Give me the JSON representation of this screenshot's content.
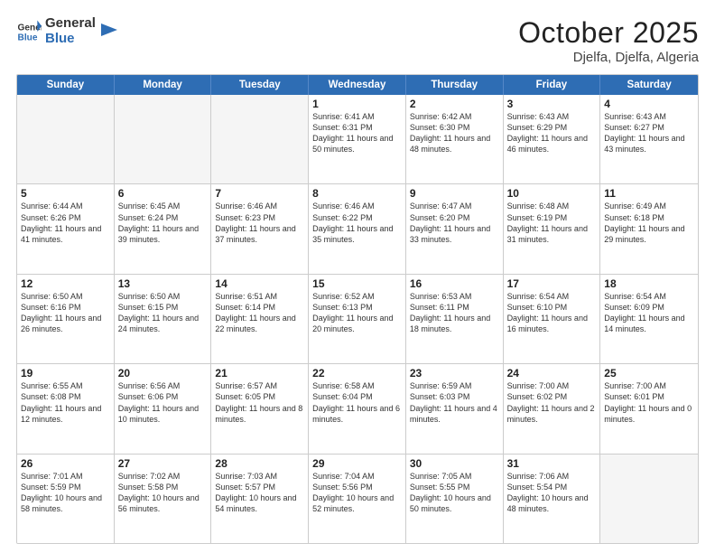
{
  "header": {
    "logo": {
      "general": "General",
      "blue": "Blue"
    },
    "title": "October 2025",
    "location": "Djelfa, Djelfa, Algeria"
  },
  "weekdays": [
    "Sunday",
    "Monday",
    "Tuesday",
    "Wednesday",
    "Thursday",
    "Friday",
    "Saturday"
  ],
  "rows": [
    [
      {
        "date": "",
        "sunrise": "",
        "sunset": "",
        "daylight": "",
        "empty": true
      },
      {
        "date": "",
        "sunrise": "",
        "sunset": "",
        "daylight": "",
        "empty": true
      },
      {
        "date": "",
        "sunrise": "",
        "sunset": "",
        "daylight": "",
        "empty": true
      },
      {
        "date": "1",
        "sunrise": "Sunrise: 6:41 AM",
        "sunset": "Sunset: 6:31 PM",
        "daylight": "Daylight: 11 hours and 50 minutes.",
        "empty": false
      },
      {
        "date": "2",
        "sunrise": "Sunrise: 6:42 AM",
        "sunset": "Sunset: 6:30 PM",
        "daylight": "Daylight: 11 hours and 48 minutes.",
        "empty": false
      },
      {
        "date": "3",
        "sunrise": "Sunrise: 6:43 AM",
        "sunset": "Sunset: 6:29 PM",
        "daylight": "Daylight: 11 hours and 46 minutes.",
        "empty": false
      },
      {
        "date": "4",
        "sunrise": "Sunrise: 6:43 AM",
        "sunset": "Sunset: 6:27 PM",
        "daylight": "Daylight: 11 hours and 43 minutes.",
        "empty": false
      }
    ],
    [
      {
        "date": "5",
        "sunrise": "Sunrise: 6:44 AM",
        "sunset": "Sunset: 6:26 PM",
        "daylight": "Daylight: 11 hours and 41 minutes.",
        "empty": false
      },
      {
        "date": "6",
        "sunrise": "Sunrise: 6:45 AM",
        "sunset": "Sunset: 6:24 PM",
        "daylight": "Daylight: 11 hours and 39 minutes.",
        "empty": false
      },
      {
        "date": "7",
        "sunrise": "Sunrise: 6:46 AM",
        "sunset": "Sunset: 6:23 PM",
        "daylight": "Daylight: 11 hours and 37 minutes.",
        "empty": false
      },
      {
        "date": "8",
        "sunrise": "Sunrise: 6:46 AM",
        "sunset": "Sunset: 6:22 PM",
        "daylight": "Daylight: 11 hours and 35 minutes.",
        "empty": false
      },
      {
        "date": "9",
        "sunrise": "Sunrise: 6:47 AM",
        "sunset": "Sunset: 6:20 PM",
        "daylight": "Daylight: 11 hours and 33 minutes.",
        "empty": false
      },
      {
        "date": "10",
        "sunrise": "Sunrise: 6:48 AM",
        "sunset": "Sunset: 6:19 PM",
        "daylight": "Daylight: 11 hours and 31 minutes.",
        "empty": false
      },
      {
        "date": "11",
        "sunrise": "Sunrise: 6:49 AM",
        "sunset": "Sunset: 6:18 PM",
        "daylight": "Daylight: 11 hours and 29 minutes.",
        "empty": false
      }
    ],
    [
      {
        "date": "12",
        "sunrise": "Sunrise: 6:50 AM",
        "sunset": "Sunset: 6:16 PM",
        "daylight": "Daylight: 11 hours and 26 minutes.",
        "empty": false
      },
      {
        "date": "13",
        "sunrise": "Sunrise: 6:50 AM",
        "sunset": "Sunset: 6:15 PM",
        "daylight": "Daylight: 11 hours and 24 minutes.",
        "empty": false
      },
      {
        "date": "14",
        "sunrise": "Sunrise: 6:51 AM",
        "sunset": "Sunset: 6:14 PM",
        "daylight": "Daylight: 11 hours and 22 minutes.",
        "empty": false
      },
      {
        "date": "15",
        "sunrise": "Sunrise: 6:52 AM",
        "sunset": "Sunset: 6:13 PM",
        "daylight": "Daylight: 11 hours and 20 minutes.",
        "empty": false
      },
      {
        "date": "16",
        "sunrise": "Sunrise: 6:53 AM",
        "sunset": "Sunset: 6:11 PM",
        "daylight": "Daylight: 11 hours and 18 minutes.",
        "empty": false
      },
      {
        "date": "17",
        "sunrise": "Sunrise: 6:54 AM",
        "sunset": "Sunset: 6:10 PM",
        "daylight": "Daylight: 11 hours and 16 minutes.",
        "empty": false
      },
      {
        "date": "18",
        "sunrise": "Sunrise: 6:54 AM",
        "sunset": "Sunset: 6:09 PM",
        "daylight": "Daylight: 11 hours and 14 minutes.",
        "empty": false
      }
    ],
    [
      {
        "date": "19",
        "sunrise": "Sunrise: 6:55 AM",
        "sunset": "Sunset: 6:08 PM",
        "daylight": "Daylight: 11 hours and 12 minutes.",
        "empty": false
      },
      {
        "date": "20",
        "sunrise": "Sunrise: 6:56 AM",
        "sunset": "Sunset: 6:06 PM",
        "daylight": "Daylight: 11 hours and 10 minutes.",
        "empty": false
      },
      {
        "date": "21",
        "sunrise": "Sunrise: 6:57 AM",
        "sunset": "Sunset: 6:05 PM",
        "daylight": "Daylight: 11 hours and 8 minutes.",
        "empty": false
      },
      {
        "date": "22",
        "sunrise": "Sunrise: 6:58 AM",
        "sunset": "Sunset: 6:04 PM",
        "daylight": "Daylight: 11 hours and 6 minutes.",
        "empty": false
      },
      {
        "date": "23",
        "sunrise": "Sunrise: 6:59 AM",
        "sunset": "Sunset: 6:03 PM",
        "daylight": "Daylight: 11 hours and 4 minutes.",
        "empty": false
      },
      {
        "date": "24",
        "sunrise": "Sunrise: 7:00 AM",
        "sunset": "Sunset: 6:02 PM",
        "daylight": "Daylight: 11 hours and 2 minutes.",
        "empty": false
      },
      {
        "date": "25",
        "sunrise": "Sunrise: 7:00 AM",
        "sunset": "Sunset: 6:01 PM",
        "daylight": "Daylight: 11 hours and 0 minutes.",
        "empty": false
      }
    ],
    [
      {
        "date": "26",
        "sunrise": "Sunrise: 7:01 AM",
        "sunset": "Sunset: 5:59 PM",
        "daylight": "Daylight: 10 hours and 58 minutes.",
        "empty": false
      },
      {
        "date": "27",
        "sunrise": "Sunrise: 7:02 AM",
        "sunset": "Sunset: 5:58 PM",
        "daylight": "Daylight: 10 hours and 56 minutes.",
        "empty": false
      },
      {
        "date": "28",
        "sunrise": "Sunrise: 7:03 AM",
        "sunset": "Sunset: 5:57 PM",
        "daylight": "Daylight: 10 hours and 54 minutes.",
        "empty": false
      },
      {
        "date": "29",
        "sunrise": "Sunrise: 7:04 AM",
        "sunset": "Sunset: 5:56 PM",
        "daylight": "Daylight: 10 hours and 52 minutes.",
        "empty": false
      },
      {
        "date": "30",
        "sunrise": "Sunrise: 7:05 AM",
        "sunset": "Sunset: 5:55 PM",
        "daylight": "Daylight: 10 hours and 50 minutes.",
        "empty": false
      },
      {
        "date": "31",
        "sunrise": "Sunrise: 7:06 AM",
        "sunset": "Sunset: 5:54 PM",
        "daylight": "Daylight: 10 hours and 48 minutes.",
        "empty": false
      },
      {
        "date": "",
        "sunrise": "",
        "sunset": "",
        "daylight": "",
        "empty": true
      }
    ]
  ]
}
